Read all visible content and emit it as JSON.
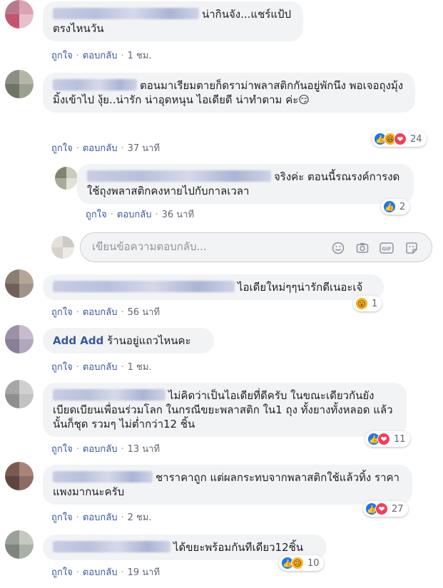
{
  "actions": {
    "like": "ถูกใจ",
    "reply": "ตอบกลับ",
    "sep": "·"
  },
  "comments": [
    {
      "text": "น่ากินจัง...แชร์แป้ป ตรงไหนวัน",
      "time": "1 ชม."
    },
    {
      "text": "ตอนมาเรียมตายก็ดราม่าพลาสติกกันอยู่พักนึง พอเจอถุงมุ้งมิ้งเข้าไป งุ้ย..น่ารัก น่าอุดหนุน ไอเดียดี น่าทำตาม ค่ะ😏",
      "time": "37 นาที",
      "reaction_count": "24",
      "reactions": [
        "like-icon",
        "haha-icon",
        "love-icon"
      ]
    },
    {
      "text": "จริงค่ะ ตอนนี้รณรงค์การงดใช้ถุงพลาสติกคงหายไปกับกาลเวลา",
      "time": "36 นาที",
      "reaction_count": "2",
      "reactions": [
        "like-icon"
      ]
    },
    {
      "text": "ไอเดียใหม่ๆๆน่ารักดีเนอะเจ้",
      "time": "56 นาที",
      "reaction_count": "1",
      "reactions": [
        "wow-icon"
      ]
    },
    {
      "author": "Add Add",
      "text": "ร้านอยู่แถวไหนคะ",
      "time": "1 ชม."
    },
    {
      "text": "ไม่คิดว่าเป็นไอเดียที่ดีครับ ในขณะเดียวกันยังเบียดเบียนเพื่อนร่วมโลก ในกรณีขยะพลาสติก ใน1 ถุง ทั้งยางทั้งหลอด แล้วนั้นก็ชุด รวมๆ ไม่ต่ำกว่า12 ชิ้น",
      "time": "13 นาที",
      "reaction_count": "11",
      "reactions": [
        "like-icon",
        "love-icon"
      ]
    },
    {
      "text": "ชาราคาถูก แต่ผลกระทบจากพลาสติกใช้แล้วทิ้ง ราคาแพงมากนะครับ",
      "time": "2 ชม.",
      "reaction_count": "27",
      "reactions": [
        "like-icon",
        "love-icon"
      ]
    },
    {
      "text": "ได้ขยะพร้อมกันทีเดียว12ชิ้น",
      "time": "19 นาที",
      "reaction_count": "10",
      "reactions": [
        "like-icon",
        "sad-icon"
      ]
    }
  ],
  "reply_box": {
    "placeholder": "เขียนข้อความตอบกลับ...",
    "tools": [
      "emoji-icon",
      "camera-icon",
      "gif-icon",
      "sticker-icon"
    ]
  },
  "colors": {
    "link": "#385898",
    "bubble": "#f2f3f5",
    "meta": "#606770"
  }
}
